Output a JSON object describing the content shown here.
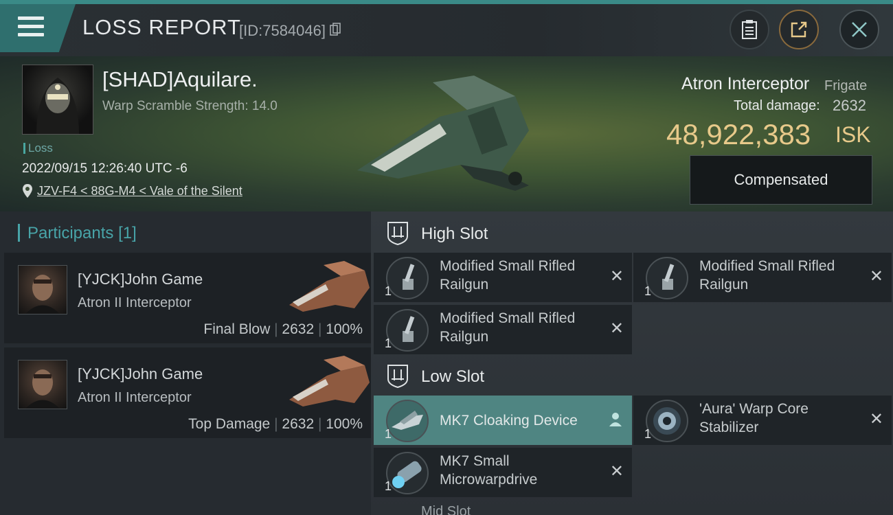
{
  "header": {
    "title": "LOSS REPORT",
    "report_id": "[ID:7584046]"
  },
  "victim": {
    "name": "[SHAD]Aquilare.",
    "warp_scramble": "Warp Scramble Strength: 14.0",
    "tag": "Loss",
    "datetime": "2022/09/15 12:26:40 UTC -6",
    "location": "JZV-F4 < 88G-M4 < Vale of the Silent",
    "ship_name": "Atron Interceptor",
    "ship_class": "Frigate",
    "total_damage_label": "Total damage:",
    "total_damage": "2632",
    "isk_value": "48,922,383",
    "isk_unit": "ISK",
    "compensated_label": "Compensated"
  },
  "participants": {
    "heading": "Participants",
    "count": "[1]",
    "rows": [
      {
        "name": "[YJCK]John Game",
        "ship": "Atron II Interceptor",
        "role": "Final Blow",
        "damage": "2632",
        "percent": "100%"
      },
      {
        "name": "[YJCK]John Game",
        "ship": "Atron II Interceptor",
        "role": "Top Damage",
        "damage": "2632",
        "percent": "100%"
      }
    ]
  },
  "slots": {
    "high": {
      "label": "High Slot",
      "modules": [
        {
          "name": "Modified Small Rifled Railgun",
          "qty": "1"
        },
        {
          "name": "Modified Small Rifled Railgun",
          "qty": "1"
        },
        {
          "name": "Modified Small Rifled Railgun",
          "qty": "1"
        }
      ]
    },
    "low": {
      "label": "Low Slot",
      "modules": [
        {
          "name": "MK7 Cloaking Device",
          "qty": "1"
        },
        {
          "name": "'Aura' Warp Core Stabilizer",
          "qty": "1"
        },
        {
          "name": "MK7 Small Microwarpdrive",
          "qty": "1"
        }
      ]
    },
    "mid_peek": "Mid Slot"
  },
  "icons": {
    "menu": "menu-icon",
    "copy": "copy-icon",
    "clipboard": "clipboard-icon",
    "share": "share-icon",
    "close": "close-icon",
    "pin": "location-pin-icon",
    "slot": "slot-shield-icon",
    "remove": "remove-x-icon",
    "person": "person-icon"
  },
  "colors": {
    "accent": "#3a8a87",
    "isk": "#e7c98a",
    "participants": "#48a4a8",
    "active_module": "#4f8582"
  }
}
